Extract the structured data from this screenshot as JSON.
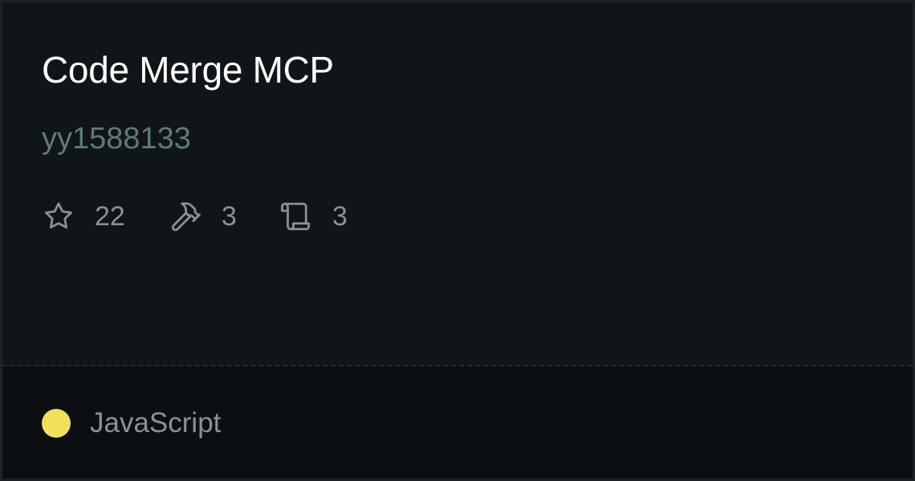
{
  "card": {
    "title": "Code Merge MCP",
    "author": "yy1588133",
    "stats": [
      {
        "icon": "star-icon",
        "value": "22"
      },
      {
        "icon": "hammer-icon",
        "value": "3"
      },
      {
        "icon": "scroll-icon",
        "value": "3"
      }
    ],
    "language": {
      "name": "JavaScript",
      "color": "#f1e05a"
    }
  },
  "colors": {
    "background": "#0f1518",
    "footer_background": "#0b0f12",
    "title": "#ffffff",
    "author": "#5e7a76",
    "muted": "#8a9096"
  }
}
